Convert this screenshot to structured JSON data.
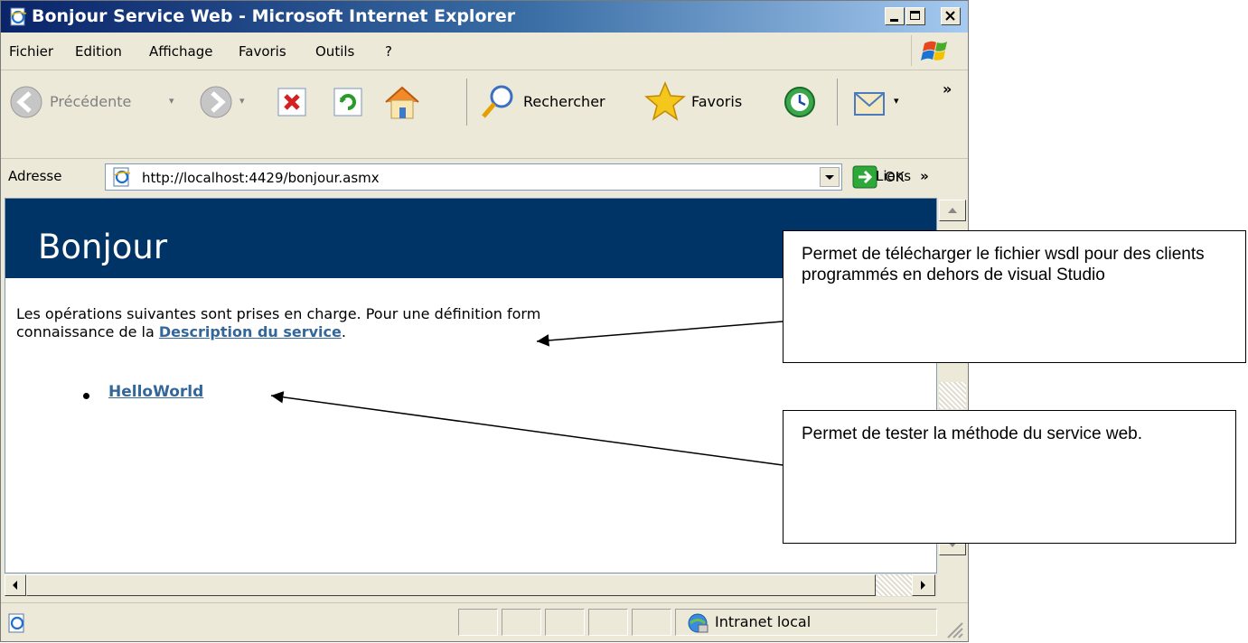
{
  "window": {
    "title": "Bonjour Service Web - Microsoft Internet Explorer"
  },
  "menu": {
    "items": [
      "Fichier",
      "Edition",
      "Affichage",
      "Favoris",
      "Outils",
      "?"
    ]
  },
  "toolbar": {
    "back_label": "Précédente",
    "search_label": "Rechercher",
    "favorites_label": "Favoris"
  },
  "address": {
    "label": "Adresse",
    "url": "http://localhost:4429/bonjour.asmx",
    "go_label": "OK",
    "links_label": "Liens"
  },
  "page": {
    "title": "Bonjour",
    "intro_line1": "Les opérations suivantes sont prises en charge. Pour une définition form",
    "intro_line2_prefix": "connaissance de la ",
    "service_desc_link": "Description du service",
    "intro_line2_suffix": ".",
    "operations": [
      "HelloWorld"
    ]
  },
  "status": {
    "zone": "Intranet local"
  },
  "callouts": [
    {
      "text": "Permet de télécharger le fichier wsdl pour des clients programmés en dehors de visual Studio"
    },
    {
      "text": "Permet de tester la méthode du service web."
    }
  ],
  "colors": {
    "page_header": "#003366",
    "link": "#336699",
    "chrome": "#ece9d8",
    "titlebar_start": "#0a246a"
  },
  "icons": {
    "title": "ie-page-icon",
    "back": "back-arrow-icon",
    "forward": "forward-arrow-icon",
    "stop": "stop-icon",
    "refresh": "refresh-icon",
    "home": "home-icon",
    "search": "search-magnifier-icon",
    "favorites": "favorites-star-icon",
    "history": "history-icon",
    "mail": "mail-icon",
    "go": "go-arrow-icon",
    "zone": "intranet-globe-icon"
  }
}
